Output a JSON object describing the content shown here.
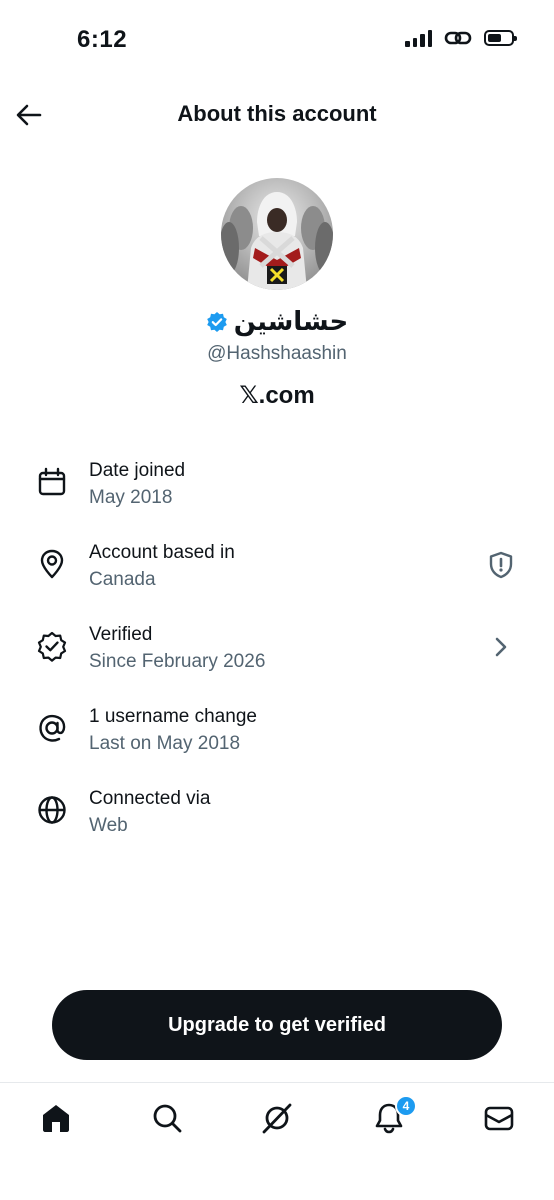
{
  "status_bar": {
    "time": "6:12"
  },
  "header": {
    "title": "About this account"
  },
  "profile": {
    "display_name": "حشاشين",
    "handle": "@Hashshaashin",
    "site": "𝕏.com"
  },
  "info": {
    "date_joined": {
      "label": "Date joined",
      "value": "May 2018"
    },
    "account_based_in": {
      "label": "Account based in",
      "value": "Canada"
    },
    "verified": {
      "label": "Verified",
      "value": "Since February 2026"
    },
    "username_changes": {
      "label": "1 username change",
      "value": "Last on May 2018"
    },
    "connected_via": {
      "label": "Connected via",
      "value": "Web"
    }
  },
  "upgrade_button": {
    "label": "Upgrade to get verified"
  },
  "tabbar": {
    "notifications_count": "4"
  },
  "icons": {
    "back": "arrow-left-icon",
    "calendar": "calendar-icon",
    "location": "location-pin-icon",
    "verified": "verified-badge-icon",
    "at": "at-sign-icon",
    "globe": "globe-icon",
    "shield": "shield-alert-icon",
    "chevron": "chevron-right-icon"
  },
  "colors": {
    "accent": "#1d9bf0",
    "text": "#0f1419",
    "secondary": "#536471",
    "button": "#0f1419"
  }
}
